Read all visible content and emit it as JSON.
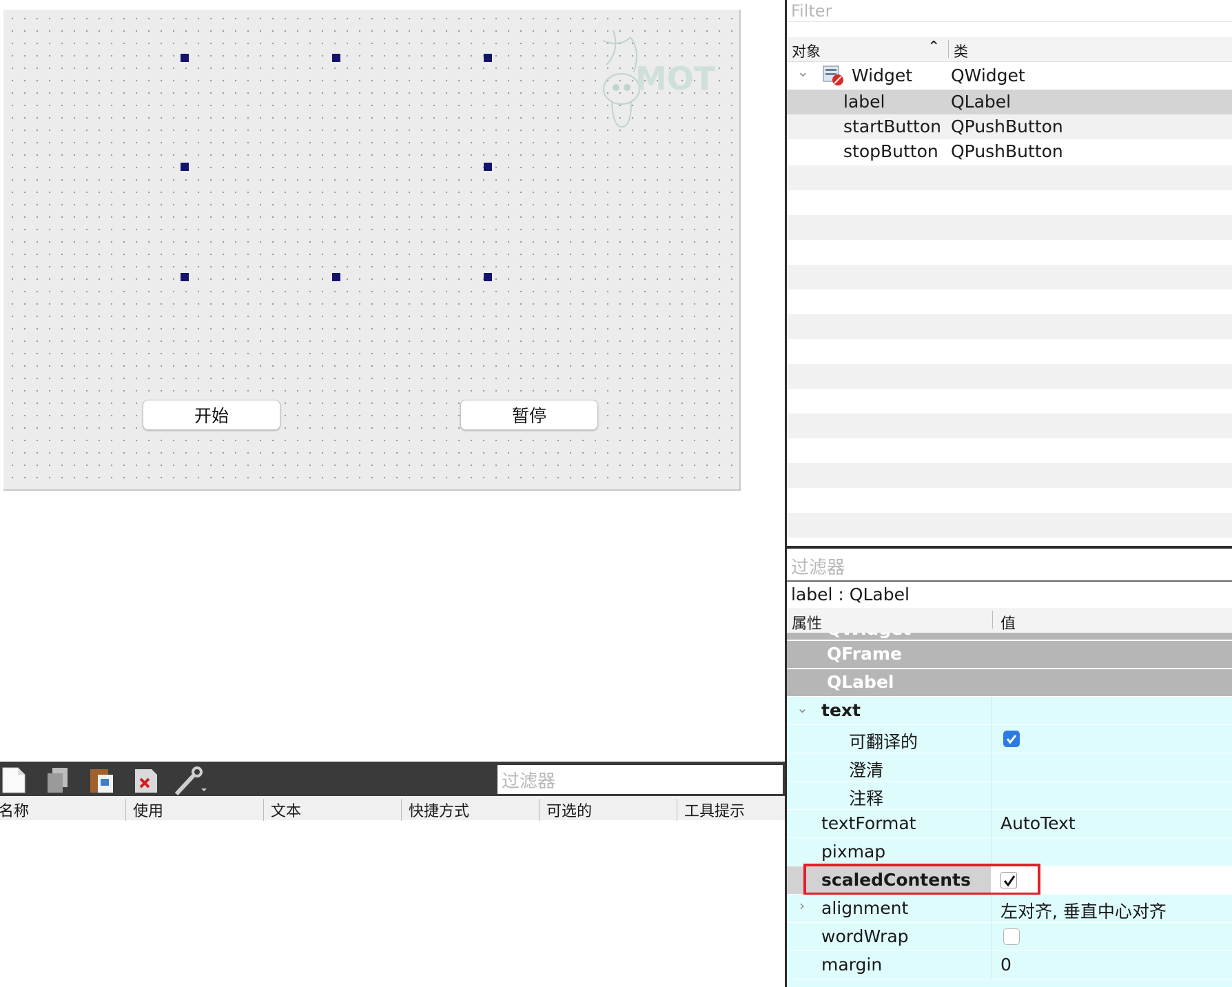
{
  "form": {
    "buttons": {
      "start": "开始",
      "stop": "暂停"
    },
    "watermark_text": "MOT"
  },
  "object_inspector": {
    "filter_placeholder": "Filter",
    "columns": {
      "object": "对象",
      "class": "类"
    },
    "rows": [
      {
        "name": "Widget",
        "class": "QWidget"
      },
      {
        "name": "label",
        "class": "QLabel"
      },
      {
        "name": "startButton",
        "class": "QPushButton"
      },
      {
        "name": "stopButton",
        "class": "QPushButton"
      }
    ]
  },
  "action_editor": {
    "filter_placeholder": "过滤器",
    "columns": [
      "名称",
      "使用",
      "文本",
      "快捷方式",
      "可选的",
      "工具提示"
    ]
  },
  "property_editor": {
    "filter_placeholder": "过滤器",
    "object_title": "label : QLabel",
    "columns": {
      "property": "属性",
      "value": "值"
    },
    "classes": [
      "QWidget",
      "QFrame",
      "QLabel"
    ],
    "props": {
      "text": "text",
      "translatable": "可翻译的",
      "disambiguation": "澄清",
      "comment": "注释",
      "textFormat": "textFormat",
      "textFormat_value": "AutoText",
      "pixmap": "pixmap",
      "scaledContents": "scaledContents",
      "alignment": "alignment",
      "alignment_value": "左对齐, 垂直中心对齐",
      "wordWrap": "wordWrap",
      "margin": "margin",
      "margin_value": "0"
    },
    "checkbox_states": {
      "translatable": true,
      "scaledContents": true,
      "wordWrap": false
    },
    "highlight_color": "#e0202a",
    "property_row_color": "#dffcfd",
    "class_row_color": "#b6b6b6"
  }
}
